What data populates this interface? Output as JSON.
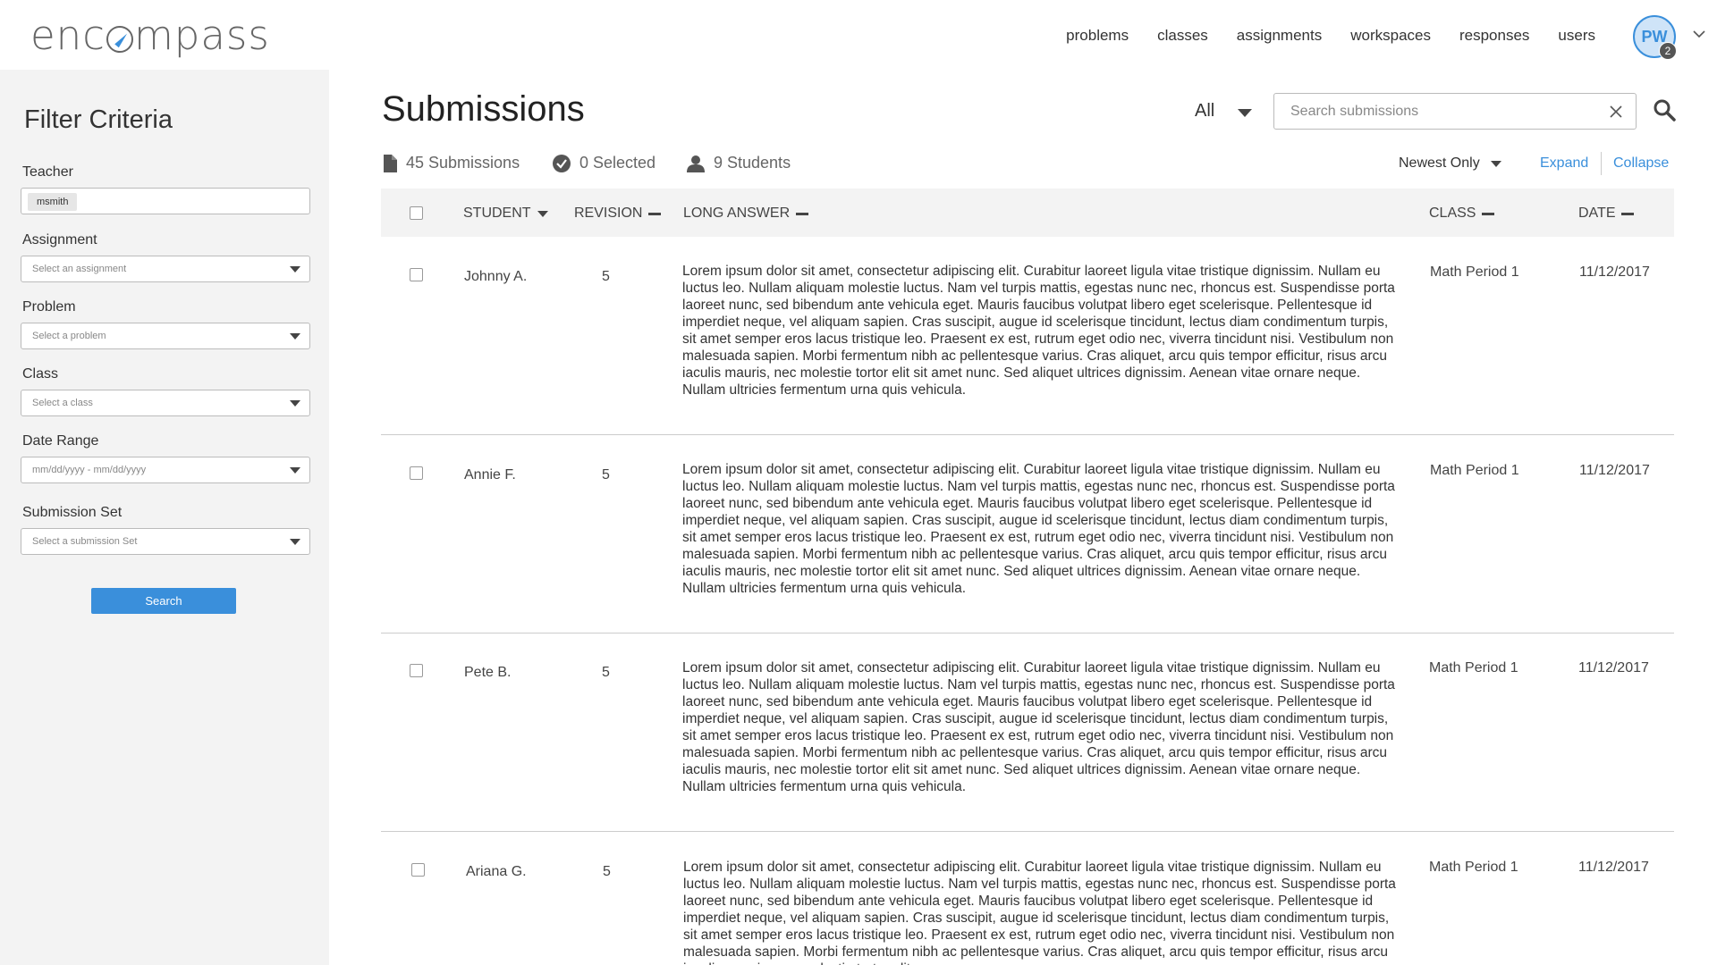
{
  "header": {
    "logo_left": "enc",
    "logo_right": "mpass",
    "nav": [
      "problems",
      "classes",
      "assignments",
      "workspaces",
      "responses",
      "users"
    ],
    "avatar_initials": "PW",
    "notification_count": "2"
  },
  "sidebar": {
    "title": "Filter Criteria",
    "teacher": {
      "label": "Teacher",
      "value": "msmith"
    },
    "assignment": {
      "label": "Assignment",
      "placeholder": "Select an assignment"
    },
    "problem": {
      "label": "Problem",
      "placeholder": "Select a problem"
    },
    "class": {
      "label": "Class",
      "placeholder": "Select a class"
    },
    "date_range": {
      "label": "Date Range",
      "placeholder": "mm/dd/yyyy - mm/dd/yyyy"
    },
    "submission_set": {
      "label": "Submission Set",
      "placeholder": "Select a submission Set"
    },
    "search_label": "Search"
  },
  "main": {
    "title": "Submissions",
    "filter_value": "All",
    "search_placeholder": "Search submissions",
    "stats": {
      "submissions": "45 Submissions",
      "selected": "0 Selected",
      "students": "9 Students"
    },
    "sort_value": "Newest Only",
    "expand_label": "Expand",
    "collapse_label": "Collapse",
    "columns": {
      "student": "STUDENT",
      "revision": "REVISION",
      "long_answer": "LONG ANSWER",
      "class": "CLASS",
      "date": "DATE"
    },
    "rows": [
      {
        "student": "Johnny A.",
        "revision": "5",
        "class": "Math Period 1",
        "date": "11/12/2017",
        "answer": "Lorem ipsum dolor sit amet, consectetur adipiscing elit. Curabitur laoreet ligula vitae tristique dignissim. Nullam eu luctus leo. Nullam aliquam molestie luctus. Nam vel turpis mattis, egestas nunc nec, rhoncus est. Suspendisse porta laoreet nunc, sed bibendum ante vehicula eget. Mauris faucibus volutpat libero eget scelerisque. Pellentesque id imperdiet neque, vel aliquam sapien. Cras suscipit, augue id scelerisque tincidunt, lectus diam condimentum turpis, sit amet semper eros lacus tristique leo. Praesent ex est, rutrum eget odio nec, viverra tincidunt nisi. Vestibulum non malesuada sapien. Morbi fermentum nibh ac pellentesque varius. Cras aliquet, arcu quis tempor efficitur, risus arcu iaculis mauris, nec molestie tortor elit sit amet nunc. Sed aliquet ultrices dignissim. Aenean vitae ornare neque. Nullam ultricies fermentum urna quis vehicula."
      },
      {
        "student": "Annie F.",
        "revision": "5",
        "class": "Math Period 1",
        "date": "11/12/2017",
        "answer": "Lorem ipsum dolor sit amet, consectetur adipiscing elit. Curabitur laoreet ligula vitae tristique dignissim. Nullam eu luctus leo. Nullam aliquam molestie luctus. Nam vel turpis mattis, egestas nunc nec, rhoncus est. Suspendisse porta laoreet nunc, sed bibendum ante vehicula eget. Mauris faucibus volutpat libero eget scelerisque. Pellentesque id imperdiet neque, vel aliquam sapien. Cras suscipit, augue id scelerisque tincidunt, lectus diam condimentum turpis, sit amet semper eros lacus tristique leo. Praesent ex est, rutrum eget odio nec, viverra tincidunt nisi. Vestibulum non malesuada sapien. Morbi fermentum nibh ac pellentesque varius. Cras aliquet, arcu quis tempor efficitur, risus arcu iaculis mauris, nec molestie tortor elit sit amet nunc. Sed aliquet ultrices dignissim. Aenean vitae ornare neque. Nullam ultricies fermentum urna quis vehicula."
      },
      {
        "student": "Pete B.",
        "revision": "5",
        "class": "Math Period 1",
        "date": "11/12/2017",
        "answer": "Lorem ipsum dolor sit amet, consectetur adipiscing elit. Curabitur laoreet ligula vitae tristique dignissim. Nullam eu luctus leo. Nullam aliquam molestie luctus. Nam vel turpis mattis, egestas nunc nec, rhoncus est. Suspendisse porta laoreet nunc, sed bibendum ante vehicula eget. Mauris faucibus volutpat libero eget scelerisque. Pellentesque id imperdiet neque, vel aliquam sapien. Cras suscipit, augue id scelerisque tincidunt, lectus diam condimentum turpis, sit amet semper eros lacus tristique leo. Praesent ex est, rutrum eget odio nec, viverra tincidunt nisi. Vestibulum non malesuada sapien. Morbi fermentum nibh ac pellentesque varius. Cras aliquet, arcu quis tempor efficitur, risus arcu iaculis mauris, nec molestie tortor elit sit amet nunc. Sed aliquet ultrices dignissim. Aenean vitae ornare neque. Nullam ultricies fermentum urna quis vehicula."
      },
      {
        "student": "Ariana G.",
        "revision": "5",
        "class": "Math Period 1",
        "date": "11/12/2017",
        "answer": "Lorem ipsum dolor sit amet, consectetur adipiscing elit. Curabitur laoreet ligula vitae tristique dignissim. Nullam eu luctus leo. Nullam aliquam molestie luctus. Nam vel turpis mattis, egestas nunc nec, rhoncus est. Suspendisse porta laoreet nunc, sed bibendum ante vehicula eget. Mauris faucibus volutpat libero eget scelerisque. Pellentesque id imperdiet neque, vel aliquam sapien. Cras suscipit, augue id scelerisque tincidunt, lectus diam condimentum turpis, sit amet semper eros lacus tristique leo. Praesent ex est, rutrum eget odio nec, viverra tincidunt nisi. Vestibulum non malesuada sapien. Morbi fermentum nibh ac pellentesque varius. Cras aliquet, arcu quis tempor efficitur, risus arcu iaculis mauris, nec molestie tortor elit"
      }
    ]
  },
  "colors": {
    "accent": "#3a8fdb",
    "sidebar_bg": "#f3f3f3",
    "table_header_bg": "#f3f3f3"
  }
}
